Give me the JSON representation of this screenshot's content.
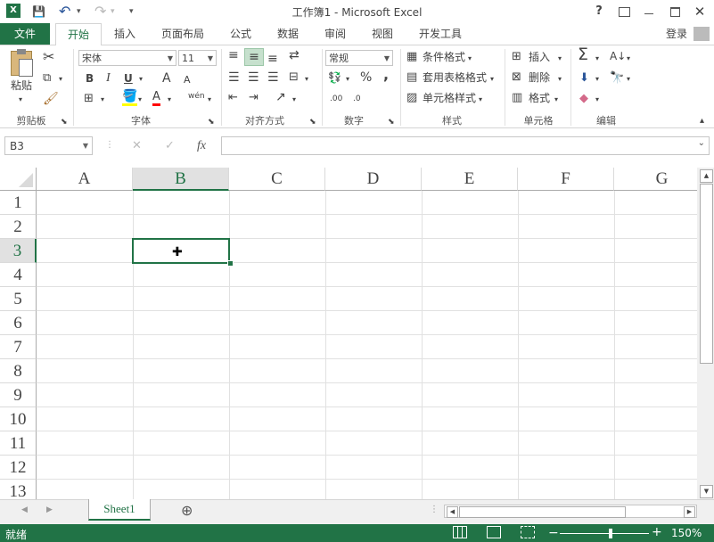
{
  "titlebar": {
    "title": "工作簿1 - Microsoft Excel",
    "help": "?",
    "qa_save": "💾",
    "qa_undo": "↶",
    "qa_redo": "↷",
    "qa_more": "▾"
  },
  "tabs": {
    "file": "文件",
    "items": [
      "开始",
      "插入",
      "页面布局",
      "公式",
      "数据",
      "审阅",
      "视图",
      "开发工具"
    ],
    "login": "登录"
  },
  "ribbon": {
    "clipboard": {
      "paste": "粘贴",
      "label": "剪贴板"
    },
    "font": {
      "name": "宋体",
      "size": "11",
      "label": "字体",
      "bold": "B",
      "italic": "I",
      "underline": "U",
      "grow": "A",
      "shrink": "A",
      "wen": "wén"
    },
    "align": {
      "label": "对齐方式"
    },
    "number": {
      "format": "常规",
      "label": "数字",
      "percent": "%",
      "comma": ","
    },
    "styles": {
      "conditional": "条件格式",
      "table": "套用表格格式",
      "cell": "单元格样式",
      "label": "样式"
    },
    "cells": {
      "insert": "插入",
      "delete": "删除",
      "format": "格式",
      "label": "单元格"
    },
    "edit": {
      "label": "编辑"
    }
  },
  "formula_bar": {
    "name_box": "B3",
    "cancel": "✕",
    "enter": "✓",
    "fx": "fx",
    "value": ""
  },
  "grid": {
    "columns": [
      "A",
      "B",
      "C",
      "D",
      "E",
      "F",
      "G"
    ],
    "rows": [
      "1",
      "2",
      "3",
      "4",
      "5",
      "6",
      "7",
      "8",
      "9",
      "10",
      "11",
      "12",
      "13"
    ],
    "active_cell": "B3"
  },
  "sheets": {
    "tabs": [
      "Sheet1"
    ],
    "add": "⊕"
  },
  "status": {
    "ready": "就绪",
    "zoom": "150%",
    "zoom_minus": "−",
    "zoom_plus": "+"
  },
  "colors": {
    "accent": "#217346",
    "selection": "#217346",
    "header_active_bg": "#e1e1e1"
  }
}
